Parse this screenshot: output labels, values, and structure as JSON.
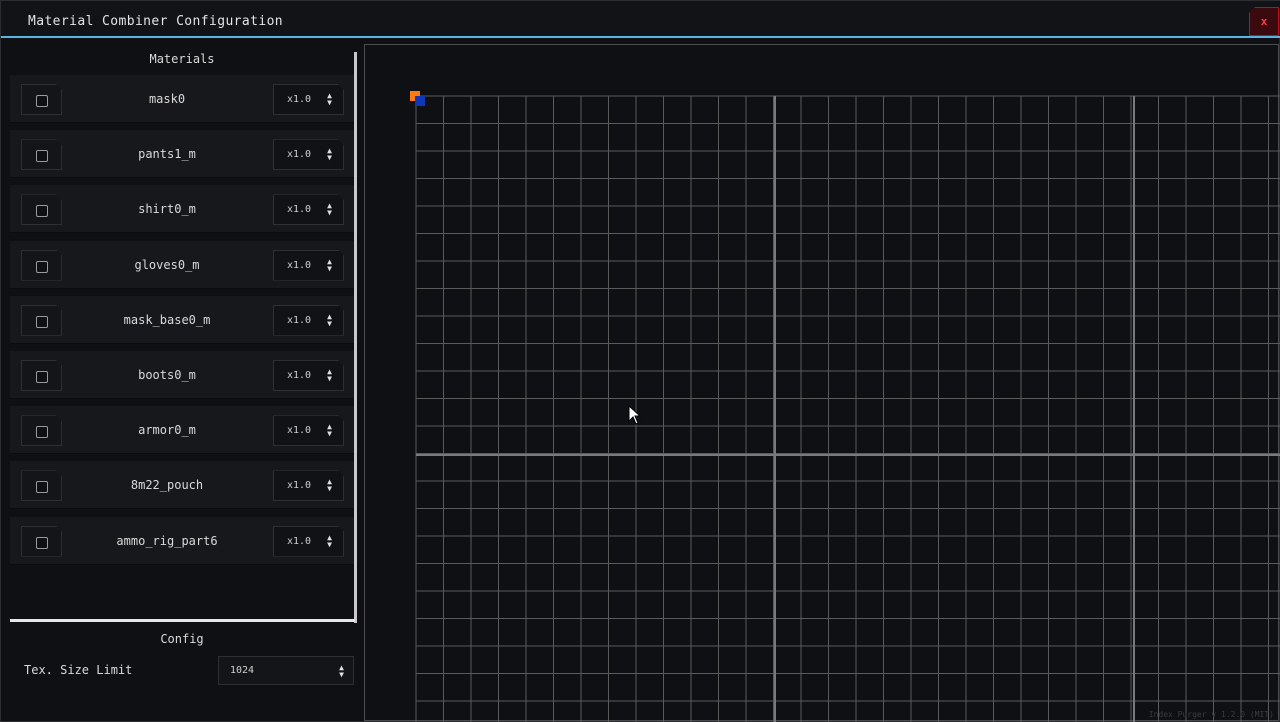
{
  "window": {
    "title": "Material Combiner Configuration",
    "close_label": "x"
  },
  "materials_panel": {
    "heading": "Materials",
    "items": [
      {
        "name": "mask0",
        "scale": "x1.0"
      },
      {
        "name": "pants1_m",
        "scale": "x1.0"
      },
      {
        "name": "shirt0_m",
        "scale": "x1.0"
      },
      {
        "name": "gloves0_m",
        "scale": "x1.0"
      },
      {
        "name": "mask_base0_m",
        "scale": "x1.0"
      },
      {
        "name": "boots0_m",
        "scale": "x1.0"
      },
      {
        "name": "armor0_m",
        "scale": "x1.0"
      },
      {
        "name": "8m22_pouch",
        "scale": "x1.0"
      },
      {
        "name": "ammo_rig_part6",
        "scale": "x1.0"
      }
    ]
  },
  "config": {
    "heading": "Config",
    "tex_size_label": "Tex. Size Limit",
    "tex_size_value": "1024"
  },
  "preview": {
    "footer": "Index Purger v 1.2.0 (MIT)"
  },
  "colors": {
    "accent": "#59b4e3",
    "close": "#b01622",
    "marker_orange": "#ff7a10",
    "marker_blue": "#1137b8",
    "grid_line": "#5a5a5a"
  },
  "icons": {
    "close": "close-icon",
    "checkbox": "checkbox-icon",
    "select_arrows": "updown-arrows-icon",
    "cursor": "mouse-pointer-icon"
  }
}
